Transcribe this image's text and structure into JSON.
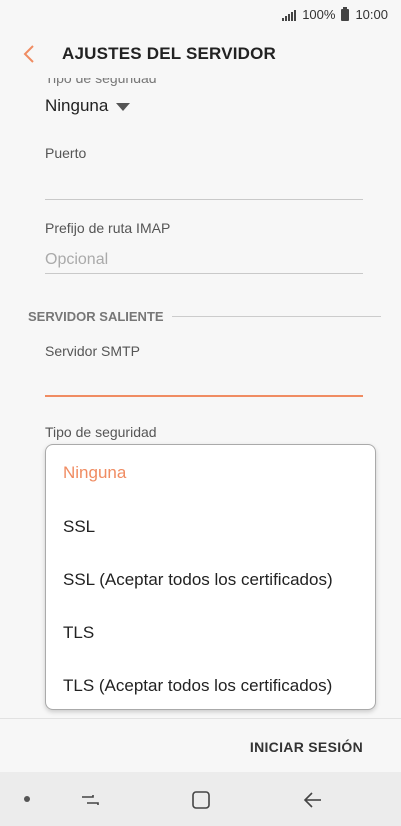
{
  "status": {
    "battery": "100%",
    "time": "10:00"
  },
  "header": {
    "title": "AJUSTES DEL SERVIDOR"
  },
  "incoming": {
    "security_label_cut": "Tipo de seguridad",
    "security_value": "Ninguna",
    "port_label": "Puerto",
    "port_value": "",
    "imap_prefix_label": "Prefijo de ruta IMAP",
    "imap_prefix_placeholder": "Opcional"
  },
  "outgoing": {
    "section_title": "SERVIDOR SALIENTE",
    "smtp_label": "Servidor SMTP",
    "smtp_value": "",
    "security_label": "Tipo de seguridad"
  },
  "dropdown": {
    "selected": "Ninguna",
    "options": [
      "Ninguna",
      "SSL",
      "SSL (Aceptar todos los certificados)",
      "TLS",
      "TLS (Aceptar todos los certificados)"
    ]
  },
  "actions": {
    "sign_in": "INICIAR SESIÓN"
  },
  "colors": {
    "accent": "#f08c62",
    "background": "#f7f7f7",
    "text": "#222222"
  },
  "icons": [
    "signal-icon",
    "battery-icon",
    "back-arrow-icon",
    "dropdown-arrow-icon",
    "recent-apps-icon",
    "home-icon",
    "back-nav-icon"
  ]
}
